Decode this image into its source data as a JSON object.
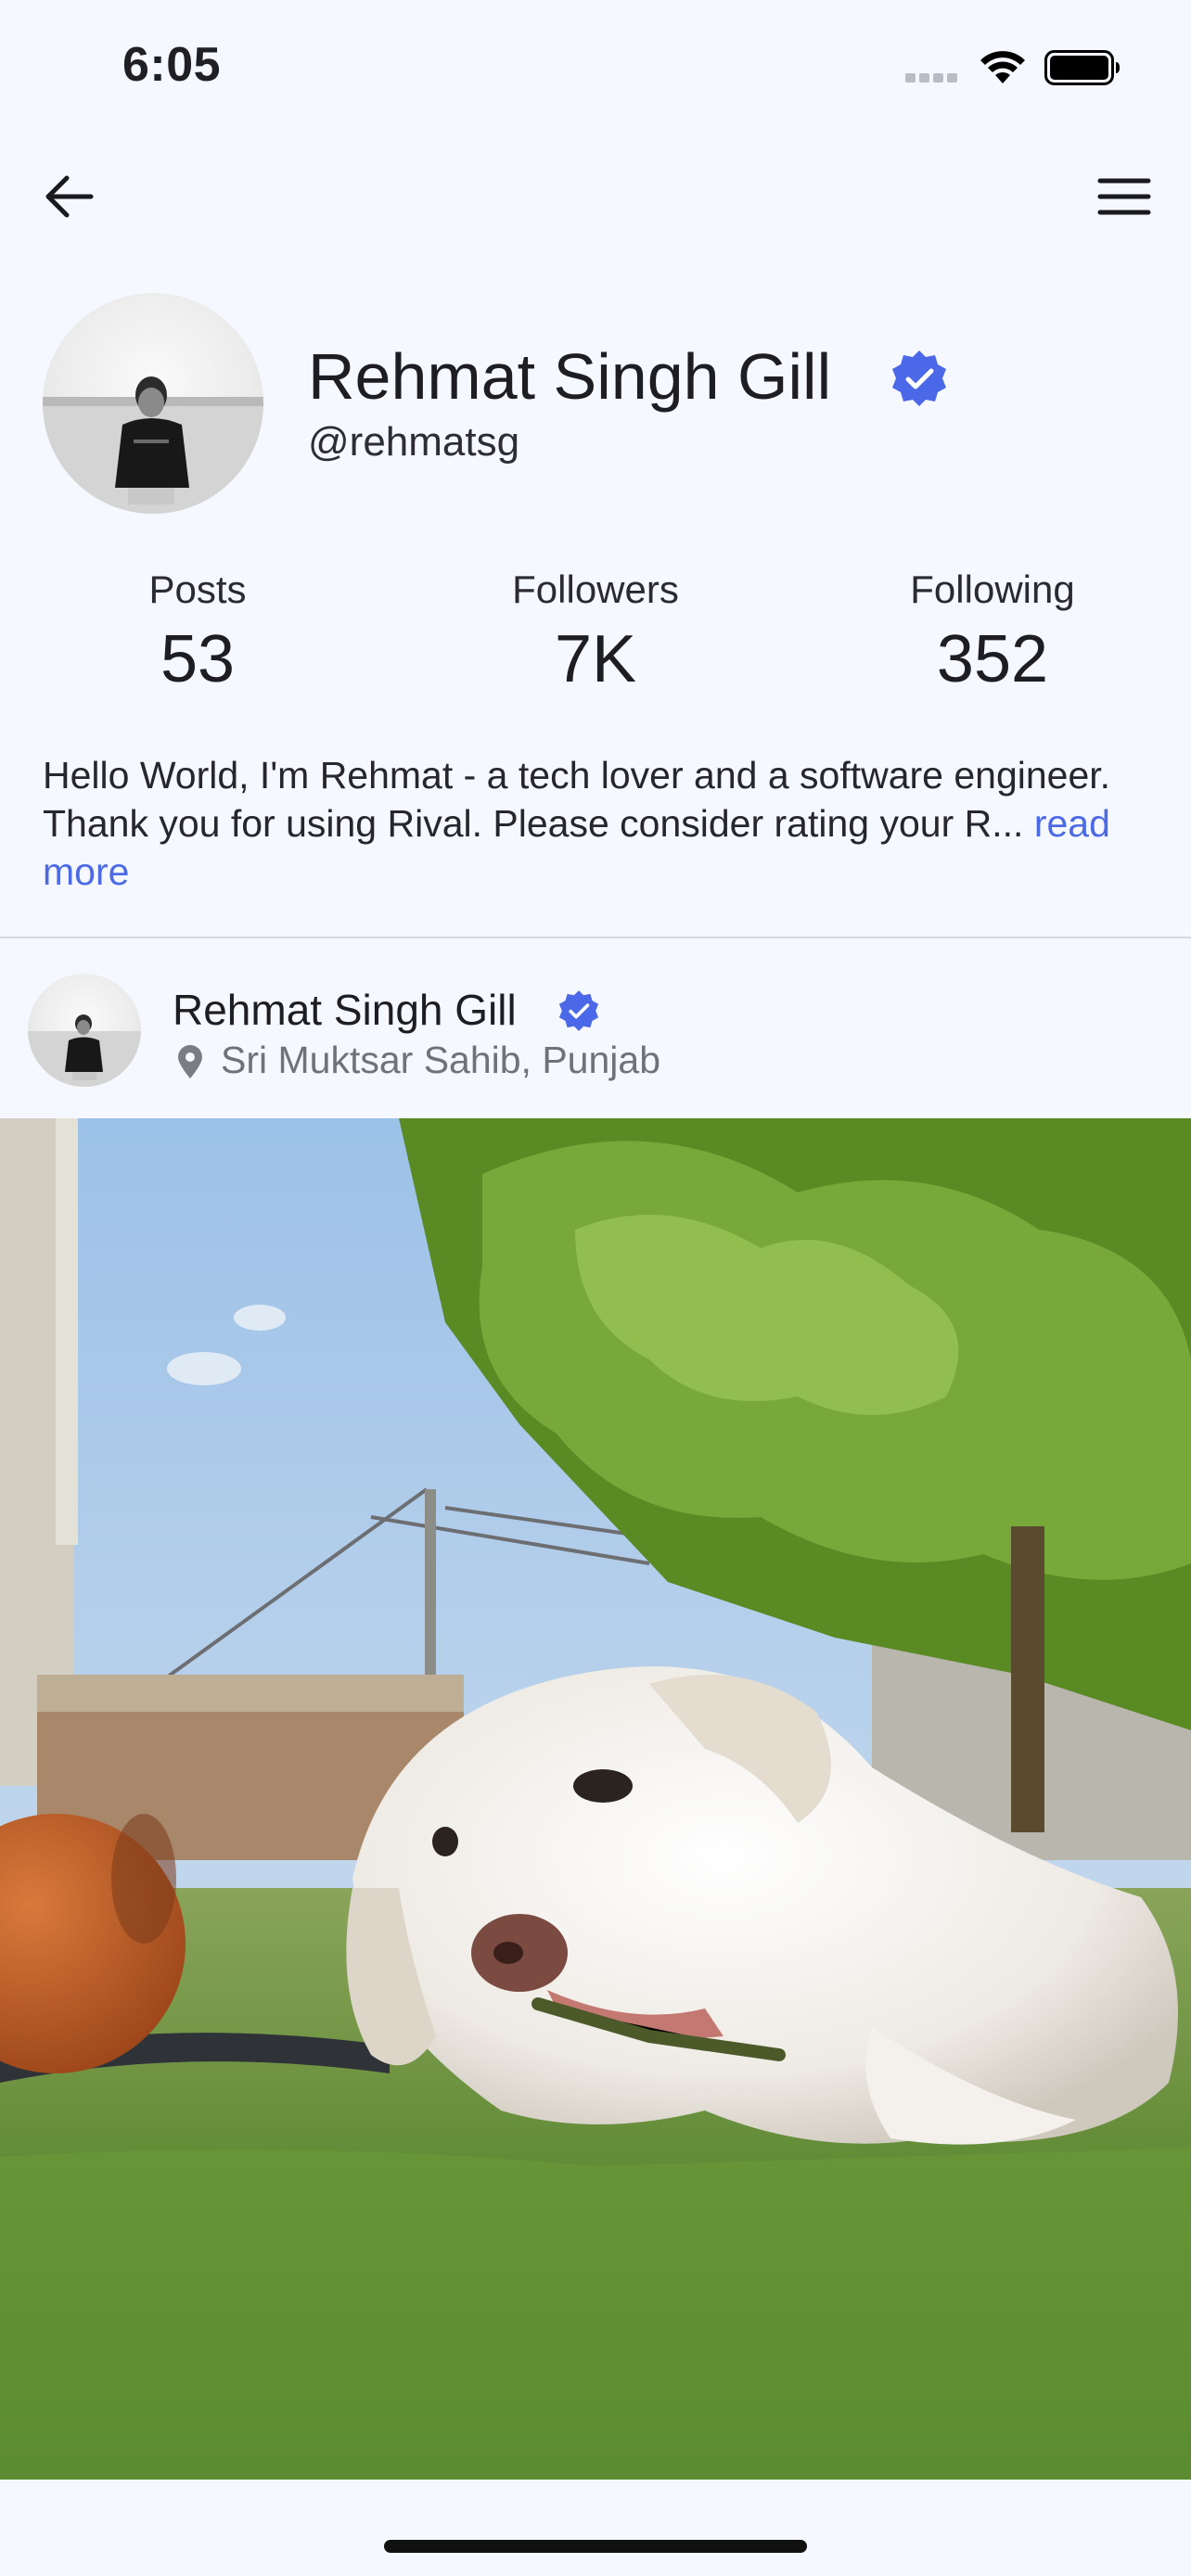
{
  "status_bar": {
    "time": "6:05"
  },
  "nav": {
    "back_icon": "arrow-left-icon",
    "menu_icon": "hamburger-menu-icon"
  },
  "profile": {
    "name": "Rehmat Singh Gill",
    "handle": "@rehmatsg",
    "verified": true,
    "stats": [
      {
        "label": "Posts",
        "value": "53"
      },
      {
        "label": "Followers",
        "value": "7K"
      },
      {
        "label": "Following",
        "value": "352"
      }
    ],
    "bio": "Hello World, I'm Rehmat - a tech lover and a software engineer. Thank you for using Rival. Please consider rating your R...",
    "read_more": "read more"
  },
  "post": {
    "author": "Rehmat Singh Gill",
    "verified": true,
    "location": "Sri Muktsar Sahib, Punjab"
  },
  "colors": {
    "background": "#f5f8fe",
    "accent": "#4d6ae6",
    "verified": "#4b68e8",
    "muted_text": "#6f7278",
    "divider": "#d6d9de"
  }
}
